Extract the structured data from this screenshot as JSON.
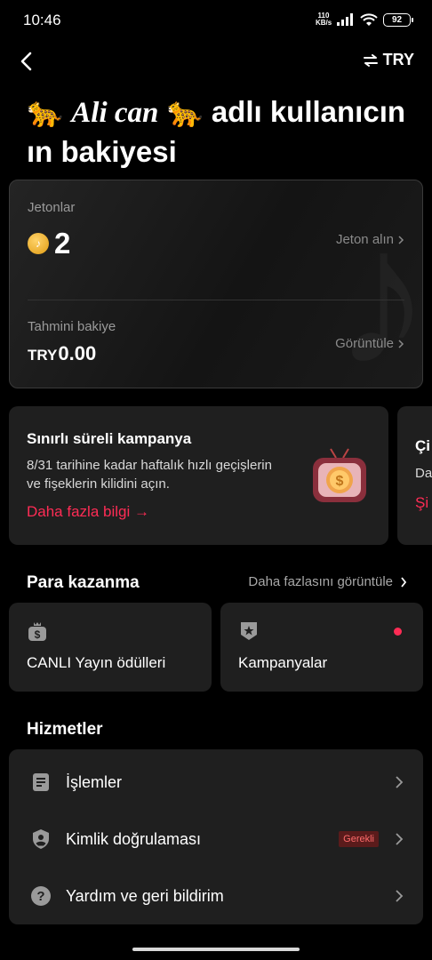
{
  "status_bar": {
    "time": "10:46",
    "net_speed_value": "110",
    "net_speed_unit": "KB/s",
    "battery": "92"
  },
  "header": {
    "currency": "TRY"
  },
  "title": {
    "emoji": "🐆",
    "username": "Ali can",
    "suffix": "adlı kullanıcın ın bakiyesi"
  },
  "balance": {
    "coins_label": "Jetonlar",
    "coins_amount": "2",
    "get_coins": "Jeton alın",
    "estimated_label": "Tahmini bakiye",
    "estimated_currency": "TRY",
    "estimated_amount": "0.00",
    "view_label": "Görüntüle"
  },
  "promo": {
    "title": "Sınırlı süreli kampanya",
    "description": "8/31 tarihine kadar haftalık hızlı geçişlerin ve fişeklerin kilidini açın.",
    "link": "Daha fazla bilgi →",
    "next_title": "Çi",
    "next_desc": "Da",
    "next_link": "Şi"
  },
  "earn": {
    "title": "Para kazanma",
    "see_more": "Daha fazlasını görüntüle",
    "items": [
      {
        "label": "CANLI Yayın ödülleri",
        "icon": "dollar-bag-icon"
      },
      {
        "label": "Kampanyalar",
        "icon": "star-badge-icon"
      }
    ]
  },
  "services": {
    "title": "Hizmetler",
    "items": [
      {
        "label": "İşlemler",
        "icon": "document-icon"
      },
      {
        "label": "Kimlik doğrulaması",
        "icon": "shield-user-icon",
        "badge": "Gerekli"
      },
      {
        "label": "Yardım ve geri bildirim",
        "icon": "help-icon"
      }
    ]
  },
  "colors": {
    "accent": "#fe2c55",
    "card": "#1f1f1f",
    "background": "#000000"
  }
}
